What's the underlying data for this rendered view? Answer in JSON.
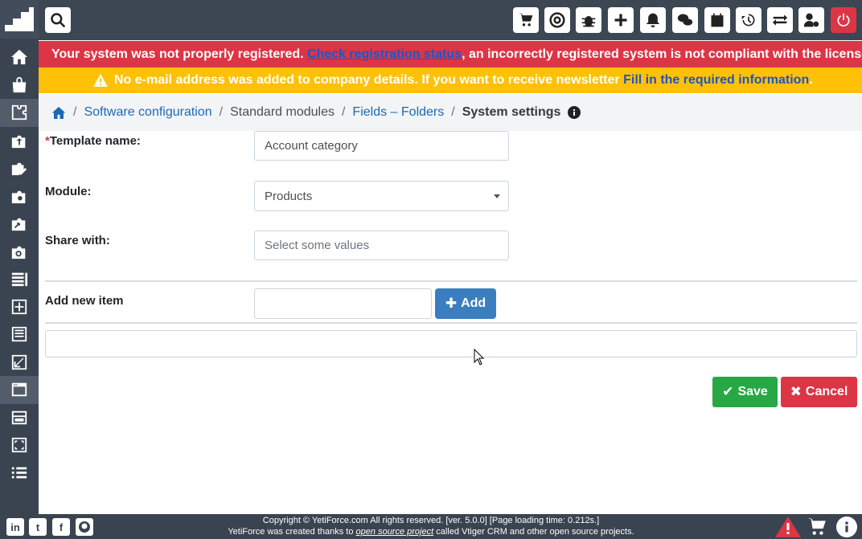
{
  "topbar": {
    "buttons": [
      "cart-icon",
      "lifebuoy-icon",
      "bug-icon",
      "plus-icon",
      "bell-icon",
      "chat-icon",
      "calendar-icon",
      "history-icon",
      "exchange-icon",
      "user-cog-icon",
      "power-icon"
    ]
  },
  "alerts": {
    "registration": {
      "prefix": "Your system was not properly registered.",
      "link": "Check registration status",
      "suffix": ", an incorrectly registered system is not compliant with the license."
    },
    "email": {
      "prefix": "No e-mail address was added to company details. If you want to receive newsletter",
      "link": "Fill in the required information",
      "suffix": "."
    }
  },
  "breadcrumb": {
    "items": [
      "Software configuration",
      "Standard modules",
      "Fields – Folders",
      "System settings"
    ]
  },
  "form": {
    "template_label": "Template name:",
    "template_value": "Account category",
    "module_label": "Module:",
    "module_value": "Products",
    "share_label": "Share with:",
    "share_placeholder": "Select some values",
    "add_item_label": "Add new item",
    "add_button": "Add",
    "save_button": "Save",
    "cancel_button": "Cancel"
  },
  "footer": {
    "line1": "Copyright © YetiForce.com All rights reserved. [ver. 5.0.0] [Page loading time: 0.212s.]",
    "line2_prefix": "YetiForce was created thanks to ",
    "line2_link": "open source project",
    "line2_suffix": " called Vtiger CRM and other open source projects.",
    "social": [
      "in",
      "t",
      "f",
      "gh"
    ]
  },
  "colors": {
    "sidebar": "#3a4350",
    "danger": "#dc3545",
    "warning": "#ffc107",
    "success": "#28a745",
    "primary": "#3a7ebf",
    "link": "#1b6ab5"
  }
}
